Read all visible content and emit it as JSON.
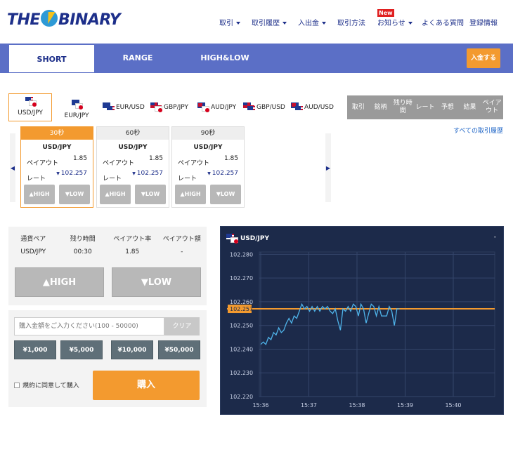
{
  "header": {
    "logo_left": "THE",
    "logo_right": "BINARY",
    "nav": [
      {
        "label": "取引",
        "caret": true
      },
      {
        "label": "取引履歴",
        "caret": true
      },
      {
        "label": "入出金",
        "caret": true
      },
      {
        "label": "取引方法",
        "caret": false
      },
      {
        "label": "お知らせ",
        "caret": true,
        "badge": "New"
      },
      {
        "label": "よくある質問",
        "caret": false
      },
      {
        "label": "登録情報",
        "caret": false
      }
    ]
  },
  "tabs": {
    "items": [
      "SHORT",
      "RANGE",
      "HIGH&LOW"
    ],
    "active": "SHORT",
    "deposit_label": "入金する"
  },
  "pairs": [
    {
      "label": "USD/JPY",
      "flags": [
        "us",
        "jp"
      ],
      "active": true
    },
    {
      "label": "EUR/JPY",
      "flags": [
        "eu",
        "jp"
      ]
    },
    {
      "label": "EUR/USD",
      "flags": [
        "eu",
        "us"
      ]
    },
    {
      "label": "GBP/JPY",
      "flags": [
        "gb",
        "jp"
      ]
    },
    {
      "label": "AUD/JPY",
      "flags": [
        "au",
        "jp"
      ]
    },
    {
      "label": "GBP/USD",
      "flags": [
        "gb",
        "us"
      ]
    },
    {
      "label": "AUD/USD",
      "flags": [
        "au",
        "us"
      ]
    }
  ],
  "history": {
    "columns": [
      "取引",
      "銘柄",
      "残り時間",
      "レート",
      "予想",
      "結果",
      "ペイアウト"
    ],
    "link": "すべての取引履歴"
  },
  "cards": [
    {
      "duration": "30秒",
      "pair": "USD/JPY",
      "payout_label": "ペイアウト",
      "payout": "1.85",
      "rate_label": "レート",
      "rate": "102.257",
      "high": "HIGH",
      "low": "LOW",
      "active": true
    },
    {
      "duration": "60秒",
      "pair": "USD/JPY",
      "payout_label": "ペイアウト",
      "payout": "1.85",
      "rate_label": "レート",
      "rate": "102.257",
      "high": "HIGH",
      "low": "LOW"
    },
    {
      "duration": "90秒",
      "pair": "USD/JPY",
      "payout_label": "ペイアウト",
      "payout": "1.85",
      "rate_label": "レート",
      "rate": "102.257",
      "high": "HIGH",
      "low": "LOW"
    }
  ],
  "trade": {
    "labels": [
      "通貨ペア",
      "残り時間",
      "ペイアウト率",
      "ペイアウト額"
    ],
    "values": [
      "USD/JPY",
      "00:30",
      "1.85",
      "-"
    ],
    "high": "HIGH",
    "low": "LOW"
  },
  "purchase": {
    "placeholder": "購入金額をご入力ください(100 - 50000)",
    "clear": "クリア",
    "amounts": [
      "¥1,000",
      "¥5,000",
      "¥10,000",
      "¥50,000"
    ],
    "agree": "規約に同意して購入",
    "buy": "購入"
  },
  "colors": {
    "accent": "#f39a2f",
    "tab_band": "#5b6fc6",
    "brand": "#1d2f8a",
    "chart_bg": "#1c2a4a",
    "chart_line": "#4fb4ea"
  },
  "chart_data": {
    "type": "line",
    "title": "USD/JPY",
    "corner": "-",
    "x_ticks": [
      "15:36",
      "15:37",
      "15:38",
      "15:39",
      "15:40"
    ],
    "y_ticks": [
      "102.280",
      "102.270",
      "102.260",
      "102.250",
      "102.240",
      "102.230",
      "102.220"
    ],
    "ylim": [
      102.22,
      102.281
    ],
    "current_rate": "102.257",
    "series": [
      {
        "values": [
          102.242,
          102.243,
          102.242,
          102.245,
          102.244,
          102.247,
          102.246,
          102.249,
          102.247,
          102.248,
          102.251,
          102.253,
          102.251,
          102.254,
          102.253,
          102.256,
          102.259,
          102.257,
          102.258,
          102.256,
          102.258,
          102.256,
          102.258,
          102.256,
          102.258,
          102.257,
          102.258,
          102.256,
          102.255,
          102.257,
          102.252,
          102.248,
          102.257,
          102.256,
          102.258,
          102.256,
          102.259,
          102.258,
          102.254,
          102.259,
          102.257,
          102.251,
          102.255,
          102.259,
          102.258,
          102.254,
          102.258,
          102.254,
          102.254,
          102.254,
          102.258,
          102.256,
          102.25,
          102.257,
          102.257
        ]
      }
    ]
  }
}
